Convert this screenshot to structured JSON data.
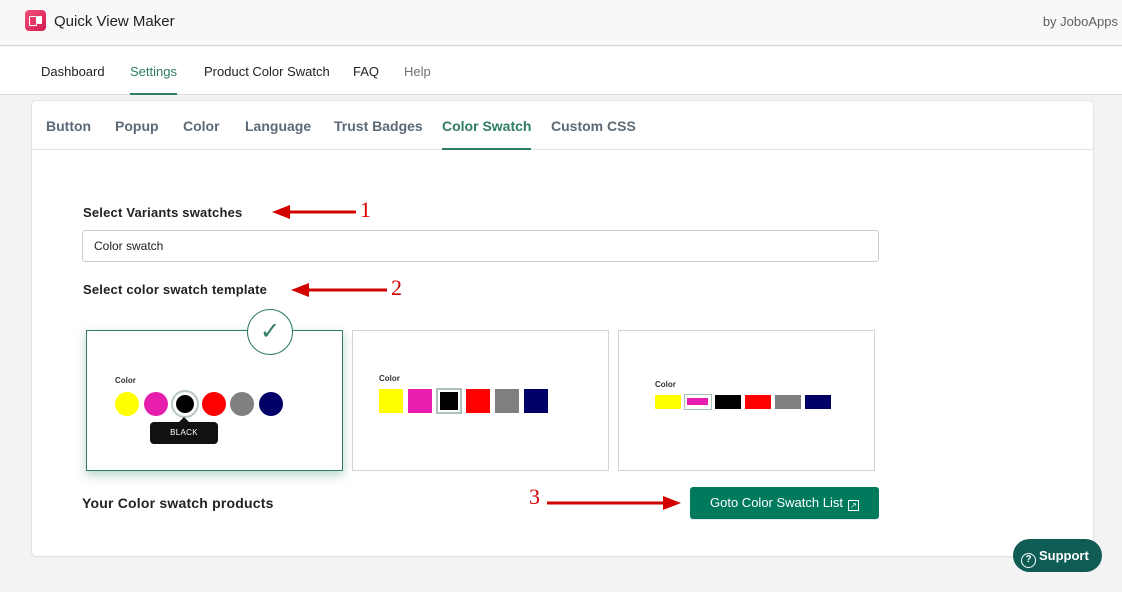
{
  "app": {
    "title": "Quick View Maker",
    "by": "by JoboApps"
  },
  "main_nav": [
    "Dashboard",
    "Settings",
    "Product Color Swatch",
    "FAQ",
    "Help"
  ],
  "sub_tabs": [
    "Button",
    "Popup",
    "Color",
    "Language",
    "Trust Badges",
    "Color Swatch",
    "Custom CSS"
  ],
  "variants": {
    "label": "Select Variants swatches",
    "value": "Color swatch"
  },
  "template": {
    "label": "Select color swatch template",
    "color_label": "Color",
    "tooltip": "BLACK",
    "check": "✓",
    "swatch_colors": [
      "#ffff00",
      "#e81fae",
      "#000000",
      "#ff0000",
      "#808080",
      "#000066"
    ]
  },
  "products": {
    "label": "Your Color swatch products",
    "button": "Goto Color Swatch List",
    "ext_icon": "↗"
  },
  "annotations": [
    "1",
    "2",
    "3"
  ],
  "support": {
    "label": "Support",
    "icon": "?"
  },
  "colors": {
    "accent": "#2e7d61",
    "button": "#007a5c",
    "annotation": "#d30000",
    "support": "#0e5c53"
  }
}
